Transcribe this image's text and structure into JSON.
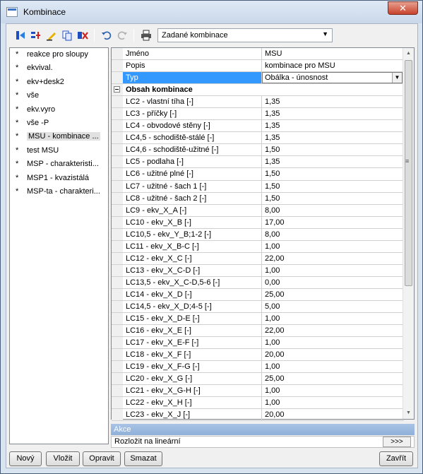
{
  "window": {
    "title": "Kombinace",
    "close_glyph": "✕"
  },
  "toolbar": {
    "icons": [
      "new-combination-icon",
      "add-combination-icon",
      "edit-icon",
      "copy-icon",
      "delete-icon",
      "undo-icon",
      "redo-icon",
      "print-icon"
    ],
    "combo_value": "Zadané kombinace"
  },
  "combinations": [
    {
      "label": "reakce pro sloupy"
    },
    {
      "label": "ekvival."
    },
    {
      "label": "ekv+desk2"
    },
    {
      "label": "vše"
    },
    {
      "label": "ekv.vyro"
    },
    {
      "label": "vše -P"
    },
    {
      "label": "MSU - kombinace ..."
    },
    {
      "label": "test MSU"
    },
    {
      "label": "MSP - charakteristi..."
    },
    {
      "label": "MSP1 - kvazistálá"
    },
    {
      "label": "MSP-ta - charakteri..."
    }
  ],
  "properties": {
    "jmeno_label": "Jméno",
    "jmeno_value": "MSU",
    "popis_label": "Popis",
    "popis_value": "kombinace pro MSU",
    "typ_label": "Typ",
    "typ_value": "Obálka - únosnost",
    "group_label": "Obsah kombinace"
  },
  "load_cases": [
    {
      "name": "LC2 - vlastní tíha [-]",
      "factor": "1,35"
    },
    {
      "name": "LC3 - příčky [-]",
      "factor": "1,35"
    },
    {
      "name": "LC4 - obvodové stěny [-]",
      "factor": "1,35"
    },
    {
      "name": "LC4,5 - schodiště-stálé [-]",
      "factor": "1,35"
    },
    {
      "name": "LC4,6 - schodiště-užitné [-]",
      "factor": "1,50"
    },
    {
      "name": "LC5 - podlaha [-]",
      "factor": "1,35"
    },
    {
      "name": "LC6 - užitné plné [-]",
      "factor": "1,50"
    },
    {
      "name": "LC7 - užitné - šach 1 [-]",
      "factor": "1,50"
    },
    {
      "name": "LC8 - užitné - šach 2 [-]",
      "factor": "1,50"
    },
    {
      "name": "LC9 - ekv_X_A [-]",
      "factor": "8,00"
    },
    {
      "name": "LC10 - ekv_X_B [-]",
      "factor": "17,00"
    },
    {
      "name": "LC10,5 - ekv_Y_B;1-2 [-]",
      "factor": "8,00"
    },
    {
      "name": "LC11 - ekv_X_B-C [-]",
      "factor": "1,00"
    },
    {
      "name": "LC12 - ekv_X_C [-]",
      "factor": "22,00"
    },
    {
      "name": "LC13 - ekv_X_C-D [-]",
      "factor": "1,00"
    },
    {
      "name": "LC13,5 - ekv_X_C-D,5-6 [-]",
      "factor": "0,00"
    },
    {
      "name": "LC14 - ekv_X_D [-]",
      "factor": "25,00"
    },
    {
      "name": "LC14,5 - ekv_X_D;4-5 [-]",
      "factor": "5,00"
    },
    {
      "name": "LC15 - ekv_X_D-E [-]",
      "factor": "1,00"
    },
    {
      "name": "LC16 - ekv_X_E [-]",
      "factor": "22,00"
    },
    {
      "name": "LC17 - ekv_X_E-F [-]",
      "factor": "1,00"
    },
    {
      "name": "LC18 - ekv_X_F [-]",
      "factor": "20,00"
    },
    {
      "name": "LC19 - ekv_X_F-G [-]",
      "factor": "1,00"
    },
    {
      "name": "LC20 - ekv_X_G [-]",
      "factor": "25,00"
    },
    {
      "name": "LC21 - ekv_X_G-H [-]",
      "factor": "1,00"
    },
    {
      "name": "LC22 - ekv_X_H [-]",
      "factor": "1,00"
    },
    {
      "name": "LC23 - ekv_X_J [-]",
      "factor": "20,00"
    }
  ],
  "akce": {
    "header": "Akce",
    "action_label": "Rozložit na lineární",
    "action_button": ">>>"
  },
  "buttons": {
    "new": "Nový",
    "insert": "Vložit",
    "edit": "Opravit",
    "delete": "Smazat",
    "close": "Zavřít"
  }
}
